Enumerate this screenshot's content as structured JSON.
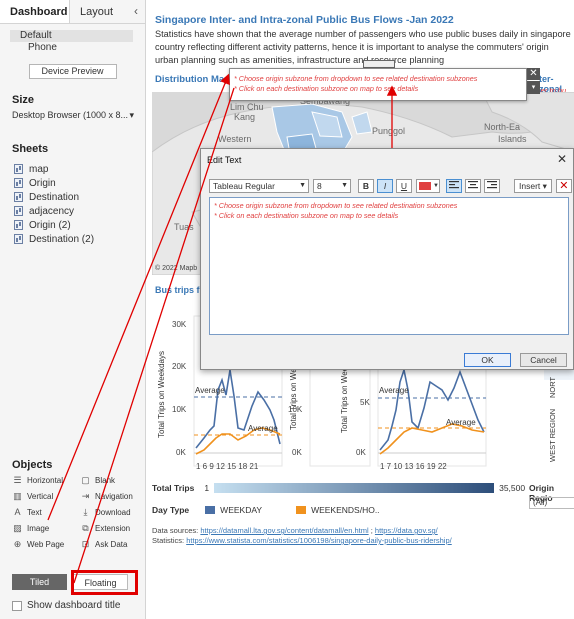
{
  "left_panel": {
    "tabs": {
      "dashboard": "Dashboard",
      "layout": "Layout",
      "collapse": "‹"
    },
    "devices": {
      "default": "Default",
      "phone": "Phone",
      "preview_button": "Device Preview"
    },
    "size": {
      "title": "Size",
      "value": "Desktop Browser (1000 x 8..."
    },
    "sheets": {
      "title": "Sheets",
      "items": [
        "map",
        "Origin",
        "Destination",
        "adjacency",
        "Origin (2)",
        "Destination (2)"
      ]
    },
    "objects": {
      "title": "Objects",
      "items": [
        {
          "label": "Horizontal",
          "icon": "horizontal-icon",
          "glyph": "☰"
        },
        {
          "label": "Blank",
          "icon": "blank-icon",
          "glyph": "▢"
        },
        {
          "label": "Vertical",
          "icon": "vertical-icon",
          "glyph": "▥"
        },
        {
          "label": "Navigation",
          "icon": "navigation-icon",
          "glyph": "⇥"
        },
        {
          "label": "Text",
          "icon": "text-icon",
          "glyph": "A"
        },
        {
          "label": "Download",
          "icon": "download-icon",
          "glyph": "⤓"
        },
        {
          "label": "Image",
          "icon": "image-icon",
          "glyph": "▨"
        },
        {
          "label": "Extension",
          "icon": "extension-icon",
          "glyph": "⧉"
        },
        {
          "label": "Web Page",
          "icon": "web-page-icon",
          "glyph": "⊕"
        },
        {
          "label": "Ask Data",
          "icon": "ask-data-icon",
          "glyph": "⊡"
        }
      ]
    },
    "layout_buttons": {
      "tiled": "Tiled",
      "floating": "Floating"
    },
    "show_title": "Show dashboard title"
  },
  "dashboard": {
    "title": "Singapore  Inter- and Intra-zonal Public Bus Flows -Jan 2022",
    "description": [
      "Statistics have shown that the average number of passengers who use public buses daily in singapore",
      "country reflecting different activity patterns, hence it is important to analyse the commuters' origin",
      "urban planning such as amenities, infrastructure and resource planning"
    ],
    "distribution_title": "Distribution Map",
    "right_title_frag": "ter-zonal",
    "right_hint_frag": "ser to bu",
    "map_labels": [
      "Lim Chu",
      "Kang",
      "Western",
      "Tuas",
      "Punggol",
      "North-Ea",
      "Islands",
      "Sembawang"
    ],
    "copyright": "© 2022 Mapb",
    "bus_trips_title": "Bus trips fr",
    "callout_lines": [
      "* Choose origin subzone from dropdown to see related destination subzones",
      "* Click on each destination subzone on map to see details"
    ],
    "callout_close": "✕",
    "callout_dropdown": "▾"
  },
  "charts": {
    "weekday_ylabel": "Total Trips on Weekdays",
    "week_ylabel_2": "Total Trips on Week",
    "week_ylabel_3": "Total Trips on Week",
    "ticks_1": [
      "30K",
      "20K",
      "10K",
      "0K"
    ],
    "ticks_2": [
      "10K",
      "0K"
    ],
    "ticks_4": [
      "5K",
      "0K"
    ],
    "xticks_1": "1  6  9 12 15 18 21",
    "xticks_3": "1  7  10 13 16 19 22",
    "average": "Average",
    "region_1": "NORT",
    "region_2": "WEST REGION"
  },
  "legend": {
    "total_trips": "Total Trips",
    "min": "1",
    "max": "35,500",
    "day_type": "Day Type",
    "weekday": "WEEKDAY",
    "weekends": "WEEKENDS/HO..",
    "weekday_color": "#4a6fa5",
    "weekends_color": "#f0921e",
    "origin_region": "Origin Regio",
    "origin_value": "(All)"
  },
  "sources": {
    "line1_prefix": "Data sources: ",
    "line1_link1": "https://datamall.lta.gov.sg/content/datamall/en.html",
    "line1_sep": " ; ",
    "line1_link2": "https://data.gov.sg/",
    "line2_prefix": "Statistics: ",
    "line2_link": "https://www.statista.com/statistics/1006198/singapore-daily-public-bus-ridership/"
  },
  "dialog": {
    "title": "Edit Text",
    "close": "✕",
    "font": "Tableau Regular",
    "size": "8",
    "bold": "B",
    "italic": "I",
    "underline": "U",
    "insert": "Insert ▾",
    "clear": "✕",
    "ok": "OK",
    "cancel": "Cancel",
    "text_color": "#e04040",
    "lines": [
      "* Choose origin subzone from dropdown to see related destination subzones",
      "* Click on each destination subzone on map to see details"
    ]
  },
  "colors": {
    "accent": "#3a78b6",
    "annotation": "#e00000",
    "hint_text": "#e04040"
  }
}
